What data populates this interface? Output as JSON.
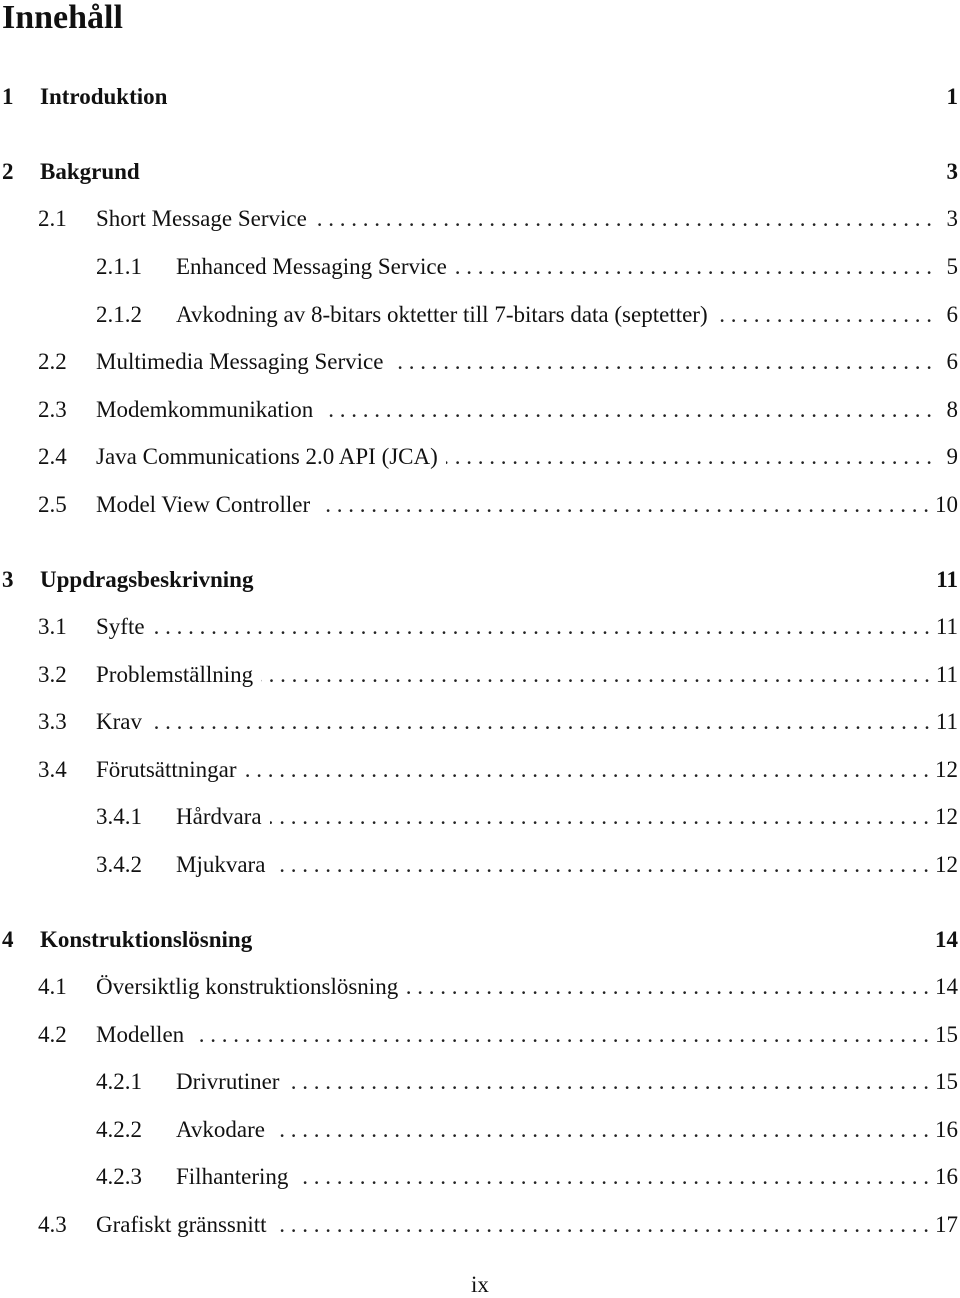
{
  "heading": "Innehåll",
  "entries": [
    {
      "level": "chapter",
      "num": "1",
      "label": "Introduktion",
      "page": "1"
    },
    {
      "level": "chapter",
      "num": "2",
      "label": "Bakgrund",
      "page": "3"
    },
    {
      "level": "section",
      "num": "2.1",
      "label": "Short Message Service",
      "page": "3"
    },
    {
      "level": "subsection",
      "num": "2.1.1",
      "label": "Enhanced Messaging Service",
      "page": "5"
    },
    {
      "level": "subsection",
      "num": "2.1.2",
      "label": "Avkodning av 8-bitars oktetter till 7-bitars data (septetter)",
      "page": "6"
    },
    {
      "level": "section",
      "num": "2.2",
      "label": "Multimedia Messaging Service",
      "page": "6"
    },
    {
      "level": "section",
      "num": "2.3",
      "label": "Modemkommunikation",
      "page": "8"
    },
    {
      "level": "section",
      "num": "2.4",
      "label": "Java Communications 2.0 API (JCA)",
      "page": "9"
    },
    {
      "level": "section",
      "num": "2.5",
      "label": "Model View Controller",
      "page": "10"
    },
    {
      "level": "chapter",
      "num": "3",
      "label": "Uppdragsbeskrivning",
      "page": "11"
    },
    {
      "level": "section",
      "num": "3.1",
      "label": "Syfte",
      "page": "11"
    },
    {
      "level": "section",
      "num": "3.2",
      "label": "Problemställning",
      "page": "11"
    },
    {
      "level": "section",
      "num": "3.3",
      "label": "Krav",
      "page": "11"
    },
    {
      "level": "section",
      "num": "3.4",
      "label": "Förutsättningar",
      "page": "12"
    },
    {
      "level": "subsection",
      "num": "3.4.1",
      "label": "Hårdvara",
      "page": "12"
    },
    {
      "level": "subsection",
      "num": "3.4.2",
      "label": "Mjukvara",
      "page": "12"
    },
    {
      "level": "chapter",
      "num": "4",
      "label": "Konstruktionslösning",
      "page": "14"
    },
    {
      "level": "section",
      "num": "4.1",
      "label": "Översiktlig konstruktionslösning",
      "page": "14"
    },
    {
      "level": "section",
      "num": "4.2",
      "label": "Modellen",
      "page": "15"
    },
    {
      "level": "subsection",
      "num": "4.2.1",
      "label": "Drivrutiner",
      "page": "15"
    },
    {
      "level": "subsection",
      "num": "4.2.2",
      "label": "Avkodare",
      "page": "16"
    },
    {
      "level": "subsection",
      "num": "4.2.3",
      "label": "Filhantering",
      "page": "16"
    },
    {
      "level": "section",
      "num": "4.3",
      "label": "Grafiskt gränssnitt",
      "page": "17"
    }
  ],
  "footer": {
    "page_number": "ix"
  }
}
